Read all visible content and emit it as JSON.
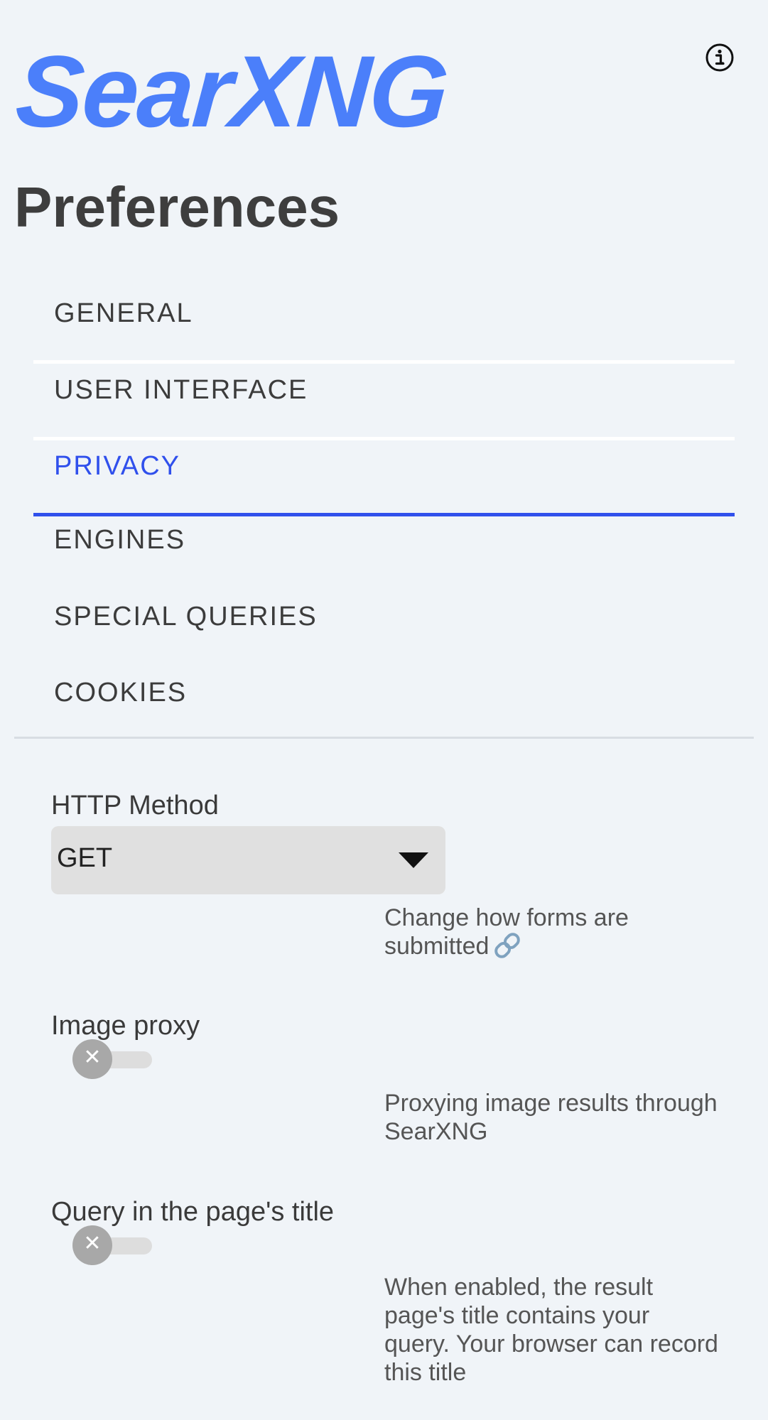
{
  "header": {
    "logo_text": "SearXNG",
    "info_icon": "info-circle-icon"
  },
  "page": {
    "title": "Preferences"
  },
  "tabs": [
    {
      "label": "GENERAL",
      "active": false
    },
    {
      "label": "USER INTERFACE",
      "active": false
    },
    {
      "label": "PRIVACY",
      "active": true
    },
    {
      "label": "ENGINES",
      "active": false
    },
    {
      "label": "SPECIAL QUERIES",
      "active": false
    },
    {
      "label": "COOKIES",
      "active": false
    }
  ],
  "settings": {
    "http_method": {
      "label": "HTTP Method",
      "value": "GET",
      "description": "Change how forms are submitted",
      "link_icon": "link-icon"
    },
    "image_proxy": {
      "label": "Image proxy",
      "enabled": false,
      "toggle_icon": "close-icon",
      "description": "Proxying image results through SearXNG"
    },
    "query_in_title": {
      "label": "Query in the page's title",
      "enabled": false,
      "toggle_icon": "close-icon",
      "description": "When enabled, the result page's title contains your query. Your browser can record this title"
    }
  },
  "colors": {
    "brand": "#4b7ffa",
    "active_tab": "#3050ec",
    "background": "#f0f4f8"
  }
}
